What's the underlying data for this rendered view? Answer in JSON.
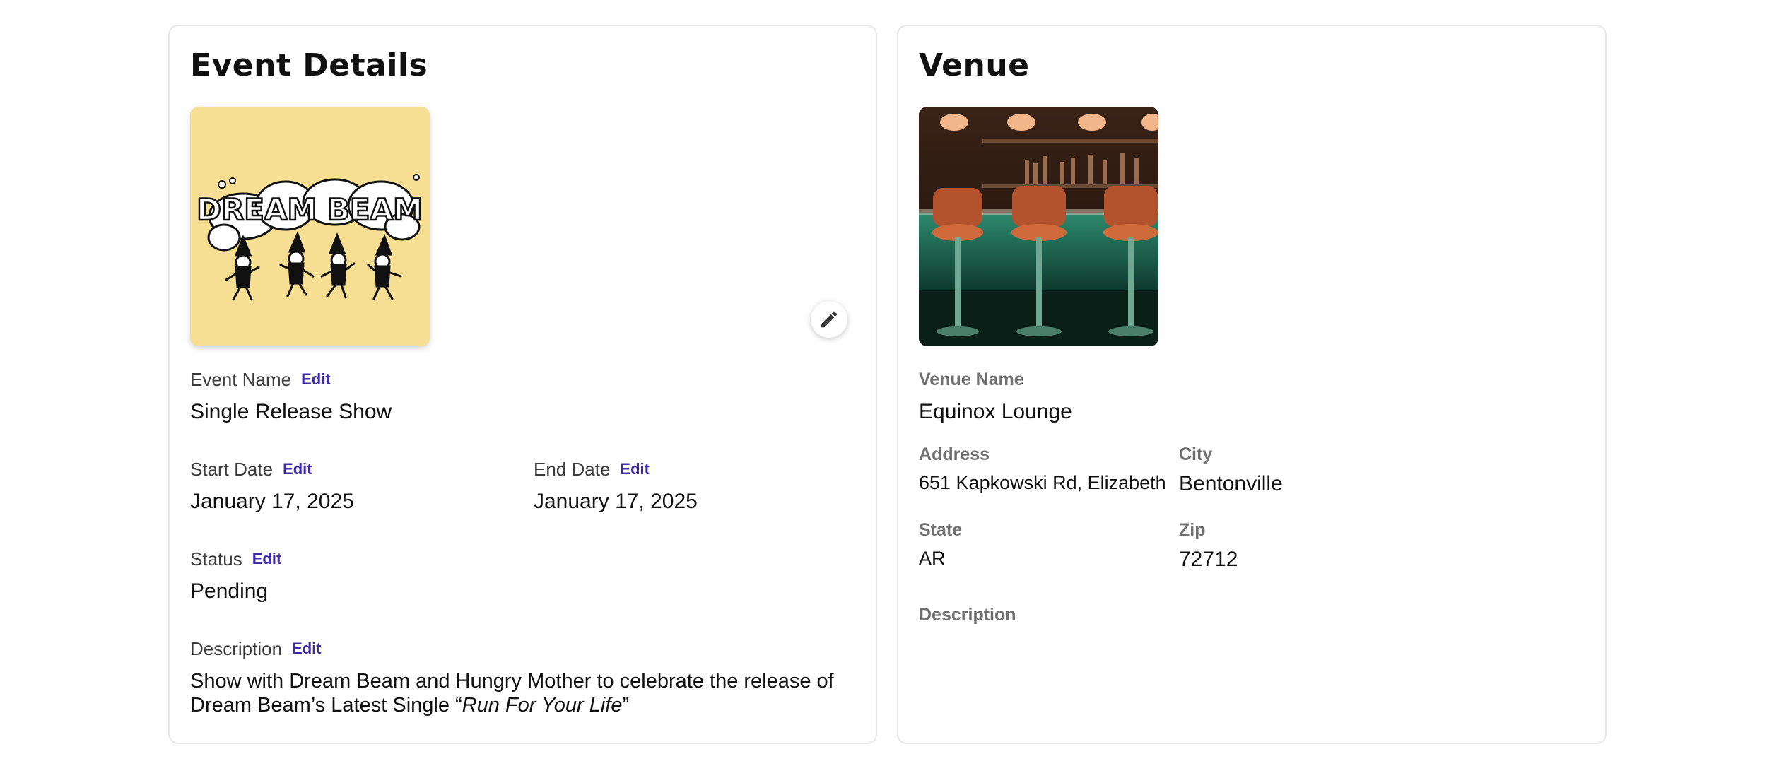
{
  "event": {
    "title": "Event Details",
    "poster_text": "DREAM BEAM",
    "fields": {
      "name": {
        "label": "Event Name",
        "value": "Single Release Show"
      },
      "start_date": {
        "label": "Start Date",
        "value": "January 17, 2025"
      },
      "end_date": {
        "label": "End Date",
        "value": "January 17, 2025"
      },
      "status": {
        "label": "Status",
        "value": "Pending"
      },
      "description": {
        "label": "Description",
        "prefix": "Show with Dream Beam and Hungry Mother to celebrate the release of Dream Beam’s Latest Single “",
        "italic": "Run For Your Life",
        "suffix": "”"
      }
    },
    "edit_label": "Edit"
  },
  "venue": {
    "title": "Venue",
    "fields": {
      "name": {
        "label": "Venue Name",
        "value": "Equinox Lounge"
      },
      "address": {
        "label": "Address",
        "value": "651 Kapkowski Rd, Elizabeth"
      },
      "city": {
        "label": "City",
        "value": "Bentonville"
      },
      "state": {
        "label": "State",
        "value": "AR"
      },
      "zip": {
        "label": "Zip",
        "value": "72712"
      },
      "description": {
        "label": "Description",
        "value": ""
      }
    }
  },
  "colors": {
    "poster_bg": "#f6de93",
    "edit_link": "#3d2aa8",
    "card_border": "#e6e6e6"
  },
  "icons": {
    "edit_fab": "pencil-icon"
  }
}
